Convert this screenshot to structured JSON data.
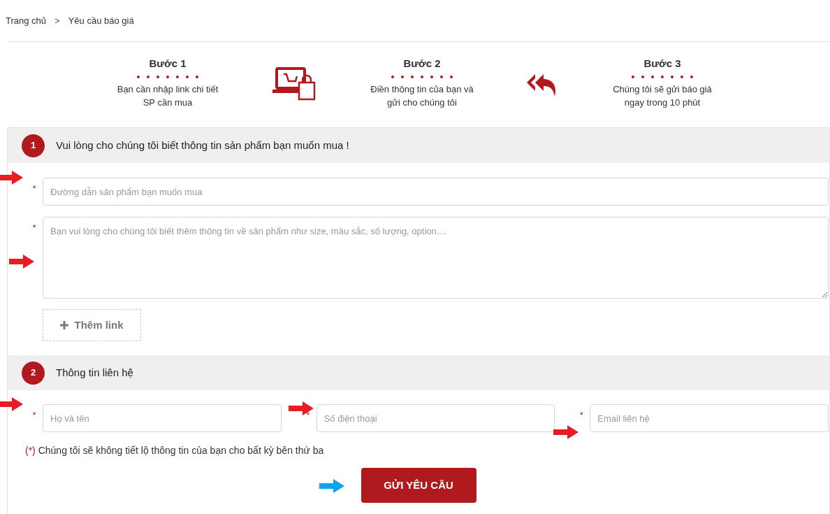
{
  "breadcrumb": [
    {
      "label": "Trang chủ"
    },
    {
      "label": "Yêu cầu báo giá"
    }
  ],
  "breadcrumb_separator": ">",
  "steps": [
    {
      "title": "Bước 1",
      "text": "Bạn cần nhập link chi tiết SP cần mua",
      "kind": "laptop-bag"
    },
    {
      "title": "Bước 2",
      "text": "Điền thông tin của bạn và gửi cho chúng tôi",
      "kind": "reply-all"
    },
    {
      "title": "Bước 3",
      "text": "Chúng tôi sẽ gửi báo giá ngay trong 10 phút"
    }
  ],
  "sections": [
    {
      "number": "1",
      "title": "Vui lòng cho chúng tôi biết thông tin sản phẩm bạn muốn mua !",
      "fields": [
        {
          "kind": "input",
          "required_mark": "*",
          "placeholder": "Đường dẫn sản phẩm bạn muốn mua",
          "arrow": {
            "color": "#e81c24",
            "kind": "top"
          }
        },
        {
          "kind": "textarea",
          "required_mark": "*",
          "placeholder": "Bạn vui lòng cho chúng tôi biết thêm thông tin về sản phẩm như size, màu sắc, số lượng, option....",
          "arrow": {
            "color": "#e81c24",
            "kind": "middle"
          }
        }
      ],
      "add_button": "Thêm link"
    },
    {
      "number": "2",
      "title": "Thông tin liên hệ",
      "fields": [
        {
          "kind": "input",
          "required_mark": "*",
          "placeholder": "Họ và tên",
          "arrow": {
            "color": "#e81c24",
            "kind": "top"
          }
        },
        {
          "kind": "input",
          "required_mark": "*",
          "placeholder": "Số điện thoại",
          "arrow": {
            "color": "#e81c24",
            "kind": "top-inside"
          }
        },
        {
          "kind": "input",
          "required_mark": "*",
          "placeholder": "Email liên hệ",
          "arrow": {
            "color": "#e81c24",
            "kind": "bottom"
          }
        }
      ],
      "note_mark": "(*)",
      "note": "Chúng tôi sẽ không tiết lộ thông tin của bạn cho bất kỳ bên thứ ba",
      "submit": {
        "label": "GỬI YÊU CẦU",
        "arrow": {
          "color": "#0ea5e9"
        }
      }
    }
  ]
}
